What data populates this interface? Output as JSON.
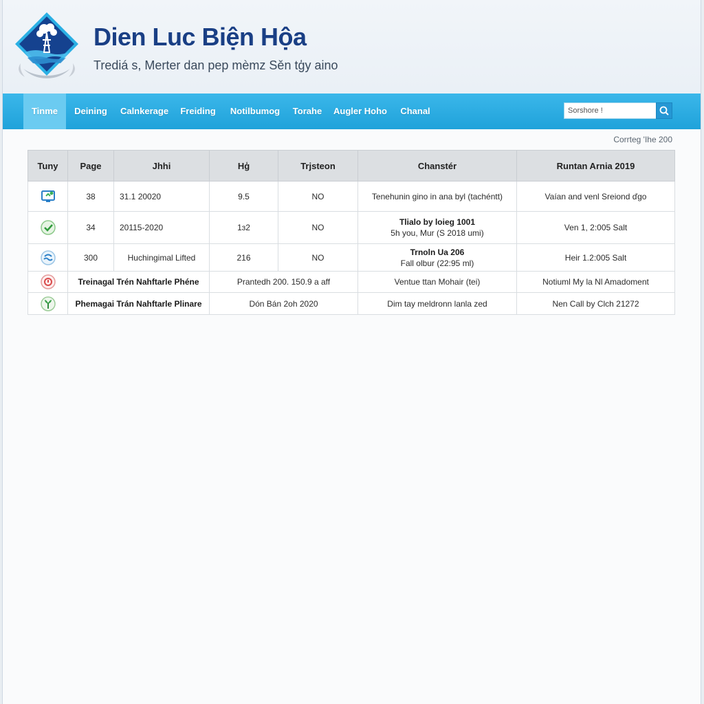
{
  "header": {
    "title": "Dien Luc Biện Hộa",
    "subtitle": "Trediá s, Merter dan pep mèmz Sěn tģy aino",
    "logo_icon": "power-tower-diamond-logo"
  },
  "nav": {
    "items": [
      {
        "label": "Tinme",
        "active": true
      },
      {
        "label": "Deining",
        "active": false
      },
      {
        "label": "Calnkerage",
        "active": false
      },
      {
        "label": "Freiding",
        "active": false
      },
      {
        "label": "Notilbumog",
        "active": false
      },
      {
        "label": "Torahe",
        "active": false
      },
      {
        "label": "Augler Hoho",
        "active": false
      },
      {
        "label": "Chanal",
        "active": false
      }
    ],
    "search": {
      "placeholder": "Sorshore !",
      "icon": "search-icon"
    }
  },
  "page_counter": "Corrteg 'Ihe 200",
  "table": {
    "headers": [
      "Tuny",
      "Page",
      "Jhhi",
      "Hģ",
      "Trjsteon",
      "Chanstér",
      "Runtan Arnia 2019"
    ],
    "rows": [
      {
        "icon": "monitor-icon",
        "page": "38",
        "date": "31.1 20020",
        "value": "9.5",
        "status": "NO",
        "channel_line1": "",
        "channel_line2": "Tenehunin gino in ana byl (tachéntt)",
        "note": "Vaían and venl Sreiond ďgo"
      },
      {
        "icon": "check-leaf-icon",
        "page": "34",
        "date": "20115-2020",
        "value": "1ɜ2",
        "status": "NO",
        "channel_line1": "Tlialo by loieg 1001",
        "channel_line2": "5h you, Mur (S 2018 umi)",
        "note": "Ven 1, 2:005 Salt"
      },
      {
        "icon": "water-wave-icon",
        "page": "300",
        "date": "Huchingimal Lifted",
        "value": "216",
        "status": "NO",
        "channel_line1": "Trnoln Ua 206",
        "channel_line2": "Fall olbur (22:95 ml)",
        "note": "Heir 1.2:005 Salt"
      }
    ],
    "wide_rows": [
      {
        "icon": "warning-alert-icon",
        "name": "Treinagal Trén Nahftarle Phéne",
        "detail": "Prantedh 200. 150.9 a aff",
        "channel": "Ventue ttan Mohair (tei)",
        "note": "Notiuml My la Nl Amadoment"
      },
      {
        "icon": "plant-icon",
        "name": "Phemagai Trán Nahftarle Plinare",
        "detail": "Dón Bán 2oh 2020",
        "channel": "Dim tay meldronn lanla zed",
        "note": "Nen Call by Clch 21272"
      }
    ]
  },
  "colors": {
    "brand_blue": "#1a3f85",
    "nav_blue": "#27a8e0",
    "nav_active": "#6bcbf1",
    "header_row_bg": "#dcdfe2"
  }
}
